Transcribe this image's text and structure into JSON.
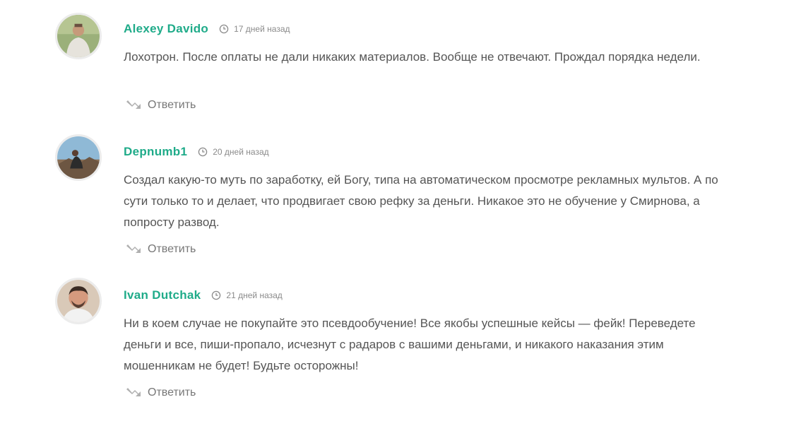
{
  "comments": [
    {
      "author": "Alexey Davido",
      "date": "17 дней назад",
      "text": "Лохотрон. После оплаты не дали никаких материалов. Вообще не отвечают. Прождал порядка недели.",
      "reply_label": "Ответить"
    },
    {
      "author": "Depnumb1",
      "date": "20 дней назад",
      "text": "Создал какую-то муть по заработку, ей Богу, типа на автоматическом просмотре рекламных мультов. А по сути только то и делает, что продвигает свою рефку за деньги. Никакое это не обучение у Смирнова, а попросту развод.",
      "reply_label": "Ответить"
    },
    {
      "author": "Ivan Dutchak",
      "date": "21 дней назад",
      "text": "Ни в коем случае не покупайте это псевдообучение! Все якобы успешные кейсы — фейк! Переведете деньги и все, пиши-пропало, исчезнут с радаров с вашими деньгами, и никакого наказания этим мошенникам не будет! Будьте осторожны!",
      "reply_label": "Ответить"
    }
  ],
  "colors": {
    "author": "#1fab89",
    "text": "#555555",
    "meta": "#8a8a8a",
    "reply_icon": "#b0b0b0"
  },
  "icons": {
    "avatar": "avatar",
    "time": "clock-icon",
    "reply": "reply-arrow-icon"
  }
}
